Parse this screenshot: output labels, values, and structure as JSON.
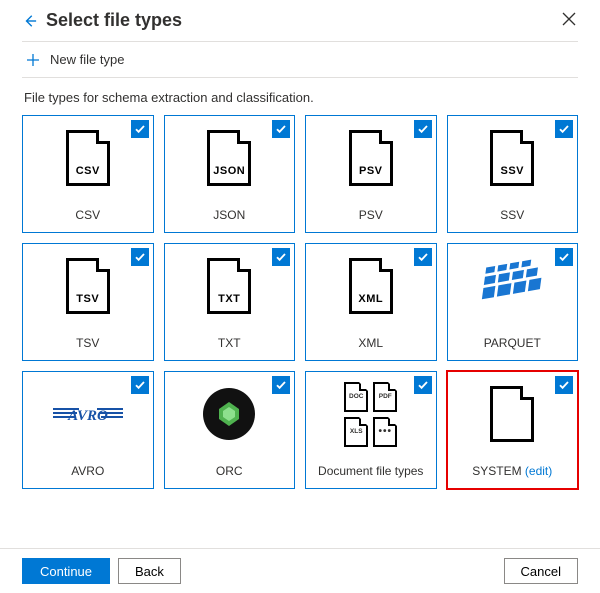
{
  "header": {
    "title": "Select file types"
  },
  "newFile": {
    "label": "New file type"
  },
  "description": "File types for schema extraction and classification.",
  "tiles": [
    {
      "ext": "CSV",
      "label": "CSV",
      "checked": true,
      "kind": "file"
    },
    {
      "ext": "JSON",
      "label": "JSON",
      "checked": true,
      "kind": "file"
    },
    {
      "ext": "PSV",
      "label": "PSV",
      "checked": true,
      "kind": "file"
    },
    {
      "ext": "SSV",
      "label": "SSV",
      "checked": true,
      "kind": "file"
    },
    {
      "ext": "TSV",
      "label": "TSV",
      "checked": true,
      "kind": "file"
    },
    {
      "ext": "TXT",
      "label": "TXT",
      "checked": true,
      "kind": "file"
    },
    {
      "ext": "XML",
      "label": "XML",
      "checked": true,
      "kind": "file"
    },
    {
      "ext": "",
      "label": "PARQUET",
      "checked": true,
      "kind": "parquet"
    },
    {
      "ext": "",
      "label": "AVRO",
      "checked": true,
      "kind": "avro"
    },
    {
      "ext": "",
      "label": "ORC",
      "checked": true,
      "kind": "orc"
    },
    {
      "ext": "",
      "label": "Document file types",
      "checked": true,
      "kind": "docgrid"
    },
    {
      "ext": "",
      "label": "SYSTEM",
      "edit": "(edit)",
      "checked": true,
      "kind": "file-blank",
      "highlight": true
    }
  ],
  "footer": {
    "continue": "Continue",
    "back": "Back",
    "cancel": "Cancel"
  }
}
